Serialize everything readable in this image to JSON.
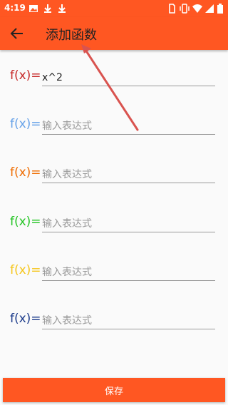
{
  "status_bar": {
    "time": "4:19",
    "left_icons": [
      "image-icon",
      "download-icon",
      "download-icon"
    ],
    "right_icons": [
      "sim-icon",
      "vibrate-icon",
      "wifi-icon",
      "signal-icon",
      "battery-icon"
    ]
  },
  "app_bar": {
    "title": "添加函数",
    "back_icon": "back-arrow-icon",
    "color": "#ff5722"
  },
  "functions": [
    {
      "label": "f(x)=",
      "value": "x^2",
      "placeholder": "输入表达式",
      "color": "#c62828"
    },
    {
      "label": "f(x)=",
      "value": "",
      "placeholder": "输入表达式",
      "color": "#64a0e8"
    },
    {
      "label": "f(x)=",
      "value": "",
      "placeholder": "输入表达式",
      "color": "#ef6c00"
    },
    {
      "label": "f(x)=",
      "value": "",
      "placeholder": "输入表达式",
      "color": "#22c422"
    },
    {
      "label": "f(x)=",
      "value": "",
      "placeholder": "输入表达式",
      "color": "#f5c518"
    },
    {
      "label": "f(x)=",
      "value": "",
      "placeholder": "输入表达式",
      "color": "#1a3a8a"
    }
  ],
  "save_button": {
    "label": "保存"
  },
  "annotation": {
    "color": "#d9534f"
  }
}
